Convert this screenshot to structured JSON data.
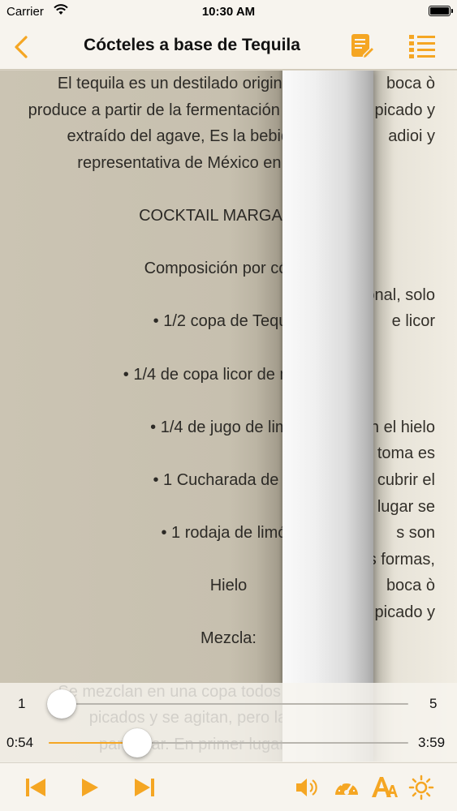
{
  "status_bar": {
    "carrier": "Carrier",
    "time": "10:30 AM"
  },
  "nav": {
    "title": "Cócteles a base de Tequila"
  },
  "accent_color": "#f5a623",
  "icons": [
    "chevron-left-icon",
    "notes-edit-icon",
    "list-icon",
    "skip-back-icon",
    "play-icon",
    "skip-forward-icon",
    "volume-icon",
    "speedometer-icon",
    "font-size-icon",
    "brightness-icon",
    "wifi-icon",
    "battery-icon"
  ],
  "page": {
    "left_lines": [
      "El tequila es un destilado original de México, se",
      "produce a partir de la fermentación de jugo del picado y",
      "extraído del agave, Es la bebida más típica y",
      "representativa de México en el extranjero.",
      "",
      "COCKTAIL MARGARITA",
      "",
      "Composición por cóctel",
      "",
      "• 1/2 copa de Tequila",
      "",
      "• 1/4 de copa licor de naranja",
      "",
      "• 1/4  de jugo de limón",
      "",
      "• 1 Cucharada de sal",
      "",
      "• 1 rodaja de limón",
      "",
      "Hielo",
      "",
      "Mezcla:",
      "",
      "Se mezclan en una copa todos los ingredientes",
      "picados y se agitan, pero la forma más",
      "particular. En primer lugar se coloca"
    ],
    "right_lines": [
      "boca ò",
      "ogui leb picado y",
      "adioi y",
      "",
      "",
      "",
      "",
      "",
      "onal, solo",
      "e licor",
      "",
      "",
      "",
      "on el hielo",
      "toma es",
      "cubrir el",
      "lugar se",
      "s son",
      "s formas,",
      "boca ò",
      "picado y"
    ]
  },
  "player": {
    "chapter_min": "1",
    "chapter_max": "5",
    "chapter_value": 1,
    "time_elapsed": "0:54",
    "time_total": "3:59",
    "progress_fraction": 0.23
  }
}
